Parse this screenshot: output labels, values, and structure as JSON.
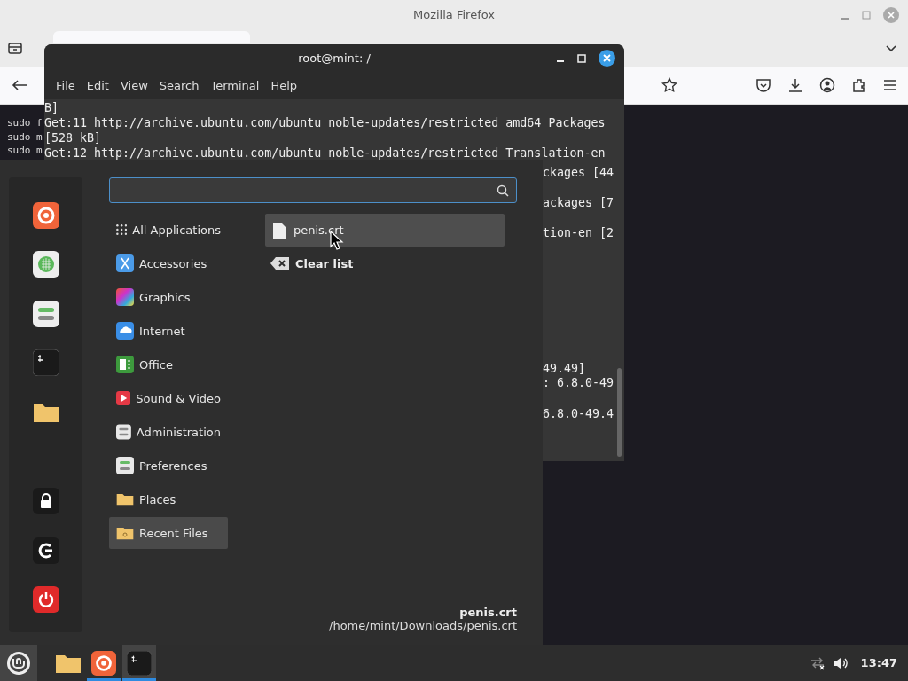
{
  "firefox": {
    "title": "Mozilla Firefox",
    "content_lines": [
      "sudo f",
      "sudo m",
      "sudo m"
    ]
  },
  "terminal": {
    "title": "root@mint: /",
    "menu": [
      "File",
      "Edit",
      "View",
      "Search",
      "Terminal",
      "Help"
    ],
    "lines": [
      "B]",
      "Get:11 http://archive.ubuntu.com/ubuntu noble-updates/restricted amd64 Packages",
      "[528 kB]",
      "Get:12 http://archive.ubuntu.com/ubuntu noble-updates/restricted Translation-en"
    ],
    "fragments": [
      "ckages [44",
      "ackages [7",
      "tion-en [2",
      "49.49]",
      ": 6.8.0-49",
      "6.8.0-49.4"
    ]
  },
  "menu": {
    "categories": [
      {
        "label": "All Applications",
        "selected": false
      },
      {
        "label": "Accessories",
        "selected": false
      },
      {
        "label": "Graphics",
        "selected": false
      },
      {
        "label": "Internet",
        "selected": false
      },
      {
        "label": "Office",
        "selected": false
      },
      {
        "label": "Sound & Video",
        "selected": false
      },
      {
        "label": "Administration",
        "selected": false
      },
      {
        "label": "Preferences",
        "selected": false
      },
      {
        "label": "Places",
        "selected": false
      },
      {
        "label": "Recent Files",
        "selected": true
      }
    ],
    "recent_files": [
      {
        "name": "penis.crt",
        "selected": true
      }
    ],
    "clear_label": "Clear list",
    "details": {
      "name": "penis.crt",
      "path": "/home/mint/Downloads/penis.crt"
    }
  },
  "taskbar": {
    "apps": [
      {
        "kind": "folder",
        "running": false,
        "selected": false
      },
      {
        "kind": "browser",
        "running": true,
        "selected": false
      },
      {
        "kind": "terminal",
        "running": true,
        "selected": true
      }
    ],
    "clock": "13:47"
  }
}
